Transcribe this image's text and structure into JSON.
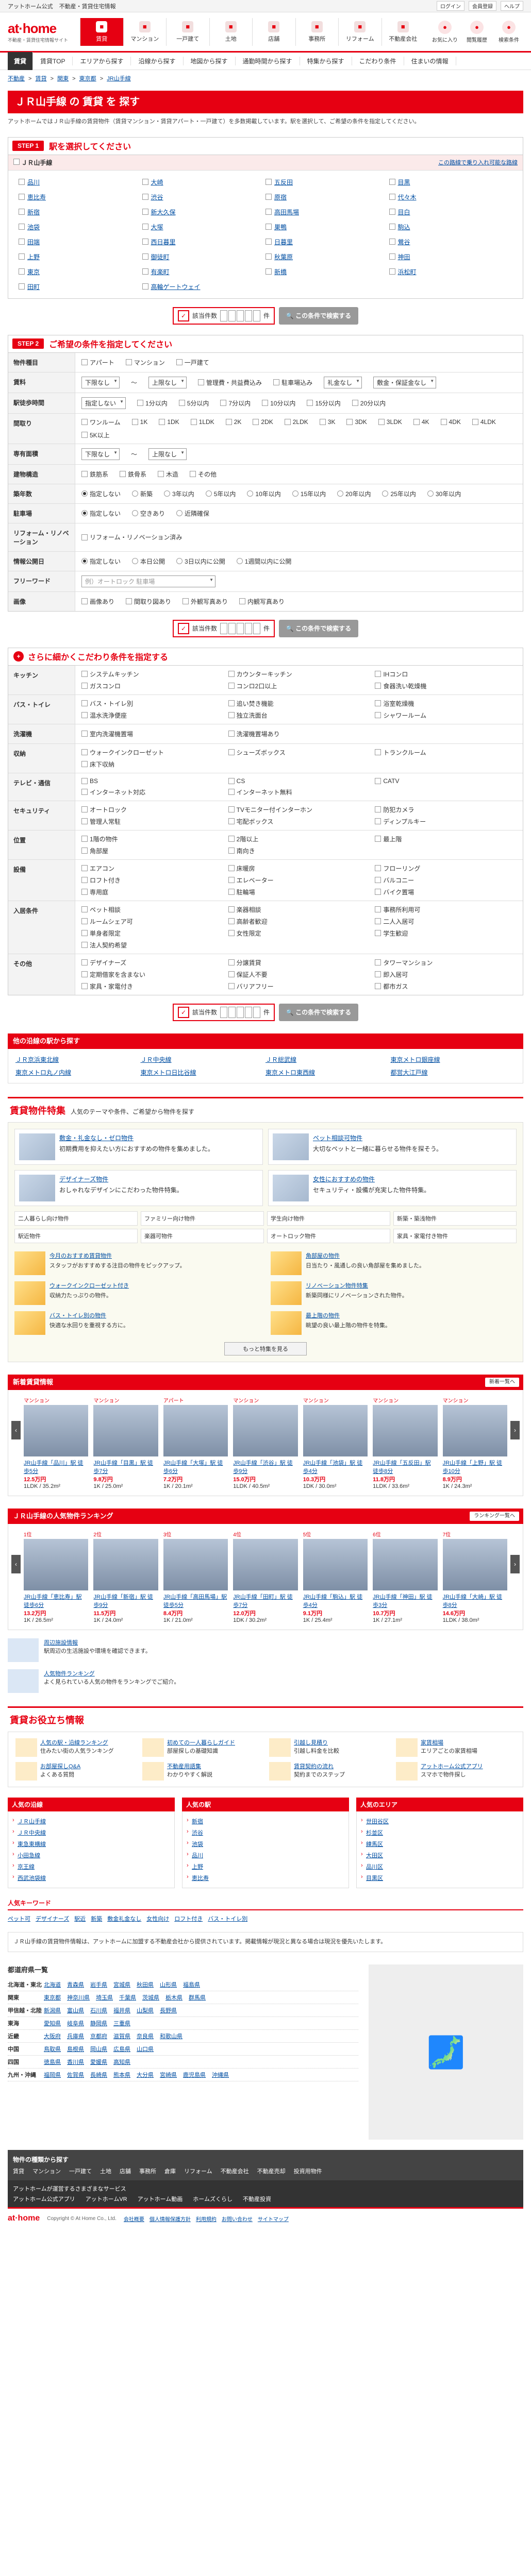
{
  "topstrip": {
    "left": [
      "アットホーム公式",
      "不動産・賃貸住宅情報"
    ],
    "right": [
      "ログイン",
      "会員登録",
      "ヘルプ"
    ]
  },
  "header": {
    "logo": "at·home",
    "logo_sub": "不動産・賃貸住宅情報サイト",
    "gnav": [
      {
        "label": "賃貸",
        "icon": "home-icon",
        "active": true
      },
      {
        "label": "マンション",
        "icon": "building-icon",
        "active": false
      },
      {
        "label": "一戸建て",
        "icon": "house-icon",
        "active": false
      },
      {
        "label": "土地",
        "icon": "land-icon",
        "active": false
      },
      {
        "label": "店舗",
        "icon": "shop-icon",
        "active": false
      },
      {
        "label": "事務所",
        "icon": "office-icon",
        "active": false
      },
      {
        "label": "リフォーム",
        "icon": "tool-icon",
        "active": false
      },
      {
        "label": "不動産会社",
        "icon": "company-icon",
        "active": false
      }
    ],
    "right": [
      {
        "label": "お気に入り",
        "icon": "heart-icon"
      },
      {
        "label": "閲覧履歴",
        "icon": "history-icon"
      },
      {
        "label": "検索条件",
        "icon": "search-icon"
      }
    ]
  },
  "subnav": [
    "賃貸",
    "賃貸TOP",
    "エリアから探す",
    "沿線から探す",
    "地図から探す",
    "通勤時間から探す",
    "特集から探す",
    "こだわり条件",
    "住まいの情報"
  ],
  "breadcrumb": [
    "不動産",
    "賃貸",
    "関東",
    "東京都",
    "JR山手線"
  ],
  "title": "ＪＲ山手線 の 賃貸 を 探す",
  "intro": "アットホームではＪＲ山手線の賃貸物件（賃貸マンション・賃貸アパート・一戸建て）を多数掲載しています。駅を選択して、ご希望の条件を指定してください。",
  "step1": {
    "num": "STEP 1",
    "title": "駅を選択してください",
    "line_label": "ＪＲ山手線",
    "line_link": "この路線で乗り入れ可能な路線",
    "stations": [
      "品川",
      "大崎",
      "五反田",
      "目黒",
      "恵比寿",
      "渋谷",
      "原宿",
      "代々木",
      "新宿",
      "新大久保",
      "高田馬場",
      "目白",
      "池袋",
      "大塚",
      "巣鴨",
      "駒込",
      "田端",
      "西日暮里",
      "日暮里",
      "鶯谷",
      "上野",
      "御徒町",
      "秋葉原",
      "神田",
      "東京",
      "有楽町",
      "新橋",
      "浜松町",
      "田町",
      "高輪ゲートウェイ"
    ]
  },
  "countbar": {
    "label": "該当件数",
    "unit": "件",
    "button": "この条件で検索する"
  },
  "step2": {
    "num": "STEP 2",
    "title": "ご希望の条件を指定してください",
    "rows": [
      {
        "label": "物件種目",
        "opts": [
          "アパート",
          "マンション",
          "一戸建て"
        ]
      },
      {
        "label": "賃料",
        "opts": [
          "下限なし",
          "〜",
          "上限なし",
          "管理費・共益費込み",
          "駐車場込み",
          "礼金なし",
          "敷金・保証金なし"
        ]
      },
      {
        "label": "駅徒歩時間",
        "opts": [
          "指定しない",
          "1分以内",
          "5分以内",
          "7分以内",
          "10分以内",
          "15分以内",
          "20分以内"
        ]
      },
      {
        "label": "間取り",
        "opts": [
          "ワンルーム",
          "1K",
          "1DK",
          "1LDK",
          "2K",
          "2DK",
          "2LDK",
          "3K",
          "3DK",
          "3LDK",
          "4K",
          "4DK",
          "4LDK",
          "5K以上"
        ]
      },
      {
        "label": "専有面積",
        "opts": [
          "下限なし",
          "〜",
          "上限なし"
        ]
      },
      {
        "label": "建物構造",
        "opts": [
          "鉄筋系",
          "鉄骨系",
          "木造",
          "その他"
        ]
      },
      {
        "label": "築年数",
        "opts": [
          "指定しない",
          "新築",
          "3年以内",
          "5年以内",
          "10年以内",
          "15年以内",
          "20年以内",
          "25年以内",
          "30年以内"
        ]
      },
      {
        "label": "駐車場",
        "opts": [
          "指定しない",
          "空きあり",
          "近隣確保"
        ]
      },
      {
        "label": "リフォーム・リノベーション",
        "opts": [
          "リフォーム・リノベーション済み"
        ]
      },
      {
        "label": "情報公開日",
        "opts": [
          "指定しない",
          "本日公開",
          "3日以内に公開",
          "1週間以内に公開"
        ]
      },
      {
        "label": "フリーワード",
        "opts": [
          "例）オートロック 駐車場"
        ]
      },
      {
        "label": "画像",
        "opts": [
          "画像あり",
          "間取り図あり",
          "外観写真あり",
          "内観写真あり"
        ]
      }
    ]
  },
  "step3": {
    "title": "さらに細かくこだわり条件を指定する",
    "rows": [
      {
        "label": "キッチン",
        "opts": [
          "システムキッチン",
          "カウンターキッチン",
          "IHコンロ",
          "ガスコンロ",
          "コンロ2口以上",
          "食器洗い乾燥機"
        ]
      },
      {
        "label": "バス・トイレ",
        "opts": [
          "バス・トイレ別",
          "追い焚き機能",
          "浴室乾燥機",
          "温水洗浄便座",
          "独立洗面台",
          "シャワールーム"
        ]
      },
      {
        "label": "洗濯機",
        "opts": [
          "室内洗濯機置場",
          "洗濯機置場あり"
        ]
      },
      {
        "label": "収納",
        "opts": [
          "ウォークインクローゼット",
          "シューズボックス",
          "トランクルーム",
          "床下収納"
        ]
      },
      {
        "label": "テレビ・通信",
        "opts": [
          "BS",
          "CS",
          "CATV",
          "インターネット対応",
          "インターネット無料"
        ]
      },
      {
        "label": "セキュリティ",
        "opts": [
          "オートロック",
          "TVモニター付インターホン",
          "防犯カメラ",
          "管理人常駐",
          "宅配ボックス",
          "ディンプルキー"
        ]
      },
      {
        "label": "位置",
        "opts": [
          "1階の物件",
          "2階以上",
          "最上階",
          "角部屋",
          "南向き"
        ]
      },
      {
        "label": "設備",
        "opts": [
          "エアコン",
          "床暖房",
          "フローリング",
          "ロフト付き",
          "エレベーター",
          "バルコニー",
          "専用庭",
          "駐輪場",
          "バイク置場"
        ]
      },
      {
        "label": "入居条件",
        "opts": [
          "ペット相談",
          "楽器相談",
          "事務所利用可",
          "ルームシェア可",
          "高齢者歓迎",
          "二人入居可",
          "単身者限定",
          "女性限定",
          "学生歓迎",
          "法人契約希望"
        ]
      },
      {
        "label": "その他",
        "opts": [
          "デザイナーズ",
          "分譲賃貸",
          "タワーマンション",
          "定期借家を含まない",
          "保証人不要",
          "即入居可",
          "家具・家電付き",
          "バリアフリー",
          "都市ガス"
        ]
      }
    ]
  },
  "other_lines": {
    "title": "他の沿線の駅から探す",
    "links": [
      "ＪＲ京浜東北線",
      "ＪＲ中央線",
      "ＪＲ総武線",
      "東京メトロ銀座線",
      "東京メトロ丸ノ内線",
      "東京メトロ日比谷線",
      "東京メトロ東西線",
      "都営大江戸線"
    ]
  },
  "feature": {
    "title": "賃貸物件特集",
    "sub": "人気のテーマや条件、ご希望から物件を探す",
    "big": [
      {
        "title": "敷金・礼金なし・ゼロ物件",
        "text": "初期費用を抑えたい方におすすめの物件を集めました。"
      },
      {
        "title": "ペット相談可物件",
        "text": "大切なペットと一緒に暮らせる物件を探そう。"
      },
      {
        "title": "デザイナーズ物件",
        "text": "おしゃれなデザインにこだわった物件特集。"
      },
      {
        "title": "女性におすすめの物件",
        "text": "セキュリティ・設備が充実した物件特集。"
      }
    ],
    "small": [
      "二人暮らし向け物件",
      "ファミリー向け物件",
      "学生向け物件",
      "新築・築浅物件",
      "駅近物件",
      "楽器可物件",
      "オートロック物件",
      "家具・家電付き物件"
    ],
    "list": [
      {
        "title": "今月のおすすめ賃貸物件",
        "text": "スタッフがおすすめする注目の物件をピックアップ。"
      },
      {
        "title": "角部屋の物件",
        "text": "日当たり・風通しの良い角部屋を集めました。"
      },
      {
        "title": "ウォークインクローゼット付き",
        "text": "収納力たっぷりの物件。"
      },
      {
        "title": "リノベーション物件特集",
        "text": "新築同様にリノベーションされた物件。"
      },
      {
        "title": "バス・トイレ別の物件",
        "text": "快適な水回りを重視する方に。"
      },
      {
        "title": "最上階の物件",
        "text": "眺望の良い最上階の物件を特集。"
      }
    ],
    "more": "もっと特集を見る"
  },
  "newprops": {
    "title": "新着賃貸情報",
    "btn": "新着一覧へ",
    "items": [
      {
        "tag": "マンション",
        "name": "JR山手線「品川」駅 徒歩5分",
        "price": "12.5万円",
        "spec": "1LDK / 35.2m²"
      },
      {
        "tag": "マンション",
        "name": "JR山手線「目黒」駅 徒歩7分",
        "price": "9.8万円",
        "spec": "1K / 25.0m²"
      },
      {
        "tag": "アパート",
        "name": "JR山手線「大塚」駅 徒歩6分",
        "price": "7.2万円",
        "spec": "1K / 20.1m²"
      },
      {
        "tag": "マンション",
        "name": "JR山手線「渋谷」駅 徒歩9分",
        "price": "15.0万円",
        "spec": "1LDK / 40.5m²"
      },
      {
        "tag": "マンション",
        "name": "JR山手線「池袋」駅 徒歩4分",
        "price": "10.3万円",
        "spec": "1DK / 30.0m²"
      },
      {
        "tag": "マンション",
        "name": "JR山手線「五反田」駅 徒歩8分",
        "price": "11.8万円",
        "spec": "1LDK / 33.6m²"
      },
      {
        "tag": "マンション",
        "name": "JR山手線「上野」駅 徒歩10分",
        "price": "8.9万円",
        "spec": "1K / 24.3m²"
      }
    ]
  },
  "ranking": {
    "title": "ＪＲ山手線の人気物件ランキング",
    "btn": "ランキング一覧へ",
    "items": [
      {
        "tag": "1位",
        "name": "JR山手線「恵比寿」駅 徒歩6分",
        "price": "13.2万円",
        "spec": "1K / 26.5m²"
      },
      {
        "tag": "2位",
        "name": "JR山手線「新宿」駅 徒歩9分",
        "price": "11.5万円",
        "spec": "1K / 24.0m²"
      },
      {
        "tag": "3位",
        "name": "JR山手線「高田馬場」駅 徒歩5分",
        "price": "8.4万円",
        "spec": "1K / 21.0m²"
      },
      {
        "tag": "4位",
        "name": "JR山手線「田町」駅 徒歩7分",
        "price": "12.0万円",
        "spec": "1DK / 30.2m²"
      },
      {
        "tag": "5位",
        "name": "JR山手線「駒込」駅 徒歩4分",
        "price": "9.1万円",
        "spec": "1K / 25.4m²"
      },
      {
        "tag": "6位",
        "name": "JR山手線「神田」駅 徒歩3分",
        "price": "10.7万円",
        "spec": "1K / 27.1m²"
      },
      {
        "tag": "7位",
        "name": "JR山手線「大崎」駅 徒歩8分",
        "price": "14.6万円",
        "spec": "1LDK / 38.0m²"
      }
    ]
  },
  "guide": [
    {
      "title": "周辺施設情報",
      "text": "駅周辺の生活施設や環境を確認できます。"
    },
    {
      "title": "人気物件ランキング",
      "text": "よく見られている人気の物件をランキングでご紹介。"
    }
  ],
  "useful": {
    "title": "賃貸お役立ち情報",
    "items": [
      {
        "title": "人気の駅・沿線ランキング",
        "text": "住みたい街の人気ランキング"
      },
      {
        "title": "初めての一人暮らしガイド",
        "text": "部屋探しの基礎知識"
      },
      {
        "title": "引越し見積り",
        "text": "引越し料金を比較"
      },
      {
        "title": "家賃相場",
        "text": "エリアごとの家賃相場"
      },
      {
        "title": "お部屋探しQ&A",
        "text": "よくある質問"
      },
      {
        "title": "不動産用語集",
        "text": "わかりやすく解説"
      },
      {
        "title": "賃貸契約の流れ",
        "text": "契約までのステップ"
      },
      {
        "title": "アットホーム公式アプリ",
        "text": "スマホで物件探し"
      }
    ]
  },
  "cols": [
    {
      "title": "人気の沿線",
      "items": [
        "ＪＲ山手線",
        "ＪＲ中央線",
        "東急東横線",
        "小田急線",
        "京王線",
        "西武池袋線"
      ]
    },
    {
      "title": "人気の駅",
      "items": [
        "新宿",
        "渋谷",
        "池袋",
        "品川",
        "上野",
        "恵比寿"
      ]
    },
    {
      "title": "人気のエリア",
      "items": [
        "世田谷区",
        "杉並区",
        "練馬区",
        "大田区",
        "品川区",
        "目黒区"
      ]
    }
  ],
  "keywords": {
    "title": "人気キーワード",
    "items": [
      "ペット可",
      "デザイナーズ",
      "駅近",
      "新築",
      "敷金礼金なし",
      "女性向け",
      "ロフト付き",
      "バス・トイレ別"
    ]
  },
  "disclaimer": "ＪＲ山手線の賃貸物件情報は、アットホームに加盟する不動産会社から提供されています。掲載情報が現況と異なる場合は現況を優先いたします。",
  "area": {
    "title": "都道府県一覧",
    "rows": [
      {
        "name": "北海道・東北",
        "items": [
          "北海道",
          "青森県",
          "岩手県",
          "宮城県",
          "秋田県",
          "山形県",
          "福島県"
        ]
      },
      {
        "name": "関東",
        "items": [
          "東京都",
          "神奈川県",
          "埼玉県",
          "千葉県",
          "茨城県",
          "栃木県",
          "群馬県"
        ]
      },
      {
        "name": "甲信越・北陸",
        "items": [
          "新潟県",
          "富山県",
          "石川県",
          "福井県",
          "山梨県",
          "長野県"
        ]
      },
      {
        "name": "東海",
        "items": [
          "愛知県",
          "岐阜県",
          "静岡県",
          "三重県"
        ]
      },
      {
        "name": "近畿",
        "items": [
          "大阪府",
          "兵庫県",
          "京都府",
          "滋賀県",
          "奈良県",
          "和歌山県"
        ]
      },
      {
        "name": "中国",
        "items": [
          "鳥取県",
          "島根県",
          "岡山県",
          "広島県",
          "山口県"
        ]
      },
      {
        "name": "四国",
        "items": [
          "徳島県",
          "香川県",
          "愛媛県",
          "高知県"
        ]
      },
      {
        "name": "九州・沖縄",
        "items": [
          "福岡県",
          "佐賀県",
          "長崎県",
          "熊本県",
          "大分県",
          "宮崎県",
          "鹿児島県",
          "沖縄県"
        ]
      }
    ]
  },
  "foot1": {
    "title": "物件の種類から探す",
    "links": [
      "賃貸",
      "マンション",
      "一戸建て",
      "土地",
      "店舗",
      "事務所",
      "倉庫",
      "リフォーム",
      "不動産会社",
      "不動産売却",
      "投資用物件"
    ]
  },
  "foot2": {
    "title": "アットホームが運営するさまざまなサービス",
    "links": [
      "アットホーム公式アプリ",
      "アットホームVR",
      "アットホーム動画",
      "ホームズくらし",
      "不動産投資"
    ]
  },
  "foot3": {
    "logo": "at·home",
    "copy": "Copyright © At Home Co., Ltd.",
    "links": [
      "会社概要",
      "個人情報保護方針",
      "利用規約",
      "お問い合わせ",
      "サイトマップ"
    ]
  }
}
